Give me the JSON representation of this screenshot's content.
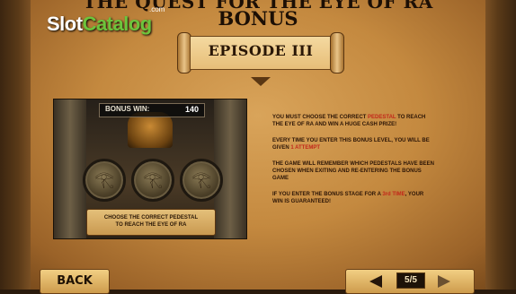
{
  "header": {
    "title_top": "THE QUEST FOR THE EYE OF RA",
    "title_bonus": "BONUS"
  },
  "watermark": {
    "slot": "Slot",
    "catalog": "Catalog",
    "com": ".com"
  },
  "episode_banner": "EPISODE III",
  "game_preview": {
    "bonus_win_label": "BONUS WIN:",
    "bonus_win_value": "140",
    "pedestal_icon": "eye-of-ra-icon",
    "caption_line1": "CHOOSE THE CORRECT PEDESTAL",
    "caption_line2": "TO REACH THE EYE OF RA"
  },
  "rules": [
    {
      "pre": "YOU MUST CHOOSE THE CORRECT ",
      "hl": "PEDESTAL",
      "post": " TO REACH THE EYE OF RA AND WIN A HUGE CASH PRIZE!"
    },
    {
      "pre": "EVERY TIME YOU ENTER THIS BONUS LEVEL, YOU WILL BE GIVEN ",
      "hl": "1 ATTEMPT",
      "post": ""
    },
    {
      "pre": "THE GAME WILL REMEMBER WHICH PEDESTALS HAVE BEEN CHOSEN WHEN EXITING AND RE-ENTERING THE BONUS GAME",
      "hl": "",
      "post": ""
    },
    {
      "pre": "IF YOU ENTER THE BONUS STAGE FOR A ",
      "hl": "3rd TIME",
      "post": ", YOUR WIN IS GUARANTEED!"
    }
  ],
  "footer": {
    "back_label": "BACK",
    "page_indicator": "5/5"
  },
  "colors": {
    "highlight": "#c2281a",
    "text_dark": "#2c1506",
    "parchment": "#c4893f"
  }
}
